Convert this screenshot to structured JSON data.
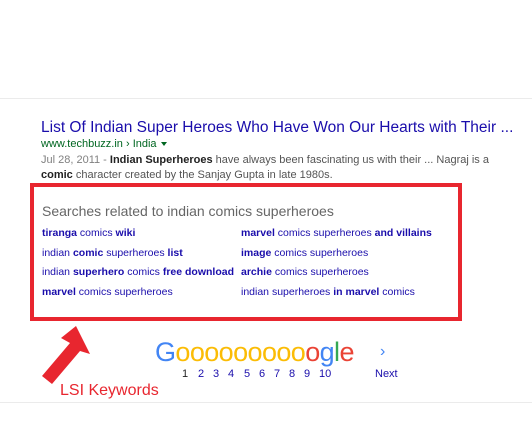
{
  "result": {
    "title": "List Of Indian Super Heroes Who Have Won Our Hearts with Their ...",
    "url": "www.techbuzz.in › India",
    "date": "Jul 28, 2011 - ",
    "snippet_parts": [
      "Indian Superheroes",
      " have always been fascinating us with their ... Nagraj is a ",
      "comic",
      " character created by the Sanjay Gupta in late 1980s."
    ]
  },
  "related": {
    "title": "Searches related to indian comics superheroes",
    "items": [
      {
        "parts": [
          [
            "b",
            "tiranga"
          ],
          [
            "n",
            " comics "
          ],
          [
            "b",
            "wiki"
          ]
        ]
      },
      {
        "parts": [
          [
            "b",
            "marvel"
          ],
          [
            "n",
            " comics superheroes "
          ],
          [
            "b",
            "and villains"
          ]
        ]
      },
      {
        "parts": [
          [
            "n",
            "indian "
          ],
          [
            "b",
            "comic"
          ],
          [
            "n",
            " superheroes "
          ],
          [
            "b",
            "list"
          ]
        ]
      },
      {
        "parts": [
          [
            "b",
            "image"
          ],
          [
            "n",
            " comics superheroes"
          ]
        ]
      },
      {
        "parts": [
          [
            "n",
            "indian "
          ],
          [
            "b",
            "superhero"
          ],
          [
            "n",
            " comics "
          ],
          [
            "b",
            "free download"
          ]
        ]
      },
      {
        "parts": [
          [
            "b",
            "archie"
          ],
          [
            "n",
            " comics superheroes"
          ]
        ]
      },
      {
        "parts": [
          [
            "b",
            "marvel"
          ],
          [
            "n",
            " comics superheroes"
          ]
        ]
      },
      {
        "parts": [
          [
            "n",
            "indian superheroes "
          ],
          [
            "b",
            "in marvel"
          ],
          [
            "n",
            " comics"
          ]
        ]
      }
    ]
  },
  "pager": {
    "logo": "Goooooooooogle",
    "pages": [
      "1",
      "2",
      "3",
      "4",
      "5",
      "6",
      "7",
      "8",
      "9",
      "10"
    ],
    "current": "1",
    "next_label": "Next",
    "next_icon": "chevron-right-icon"
  },
  "annotation": {
    "label": "LSI Keywords",
    "color": "#e8262f"
  }
}
